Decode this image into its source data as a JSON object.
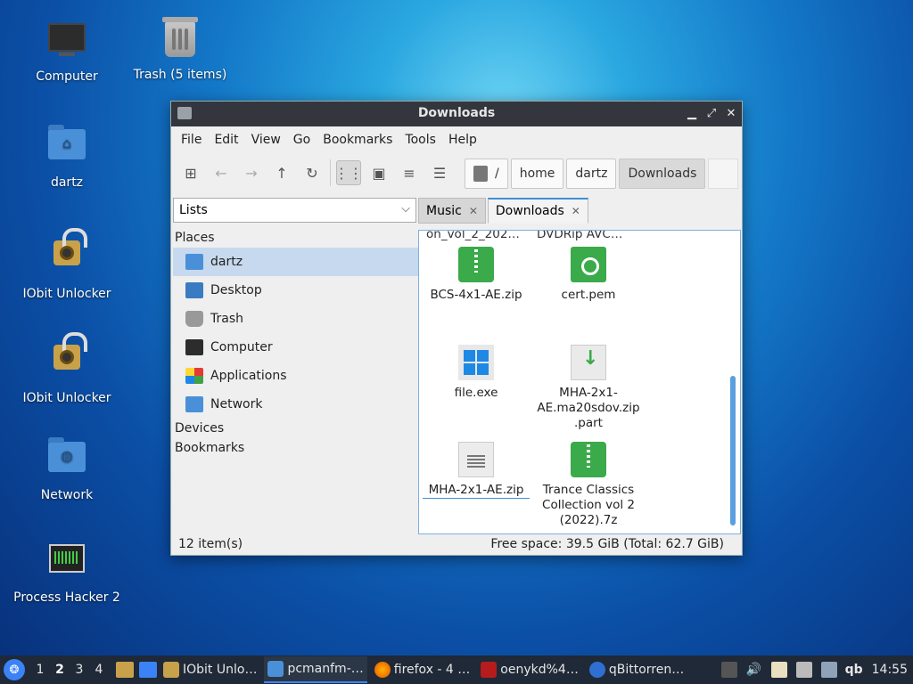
{
  "desktop": {
    "icons": [
      {
        "label": "Computer"
      },
      {
        "label": "Trash (5 items)"
      },
      {
        "label": "dartz"
      },
      {
        "label": "IObit Unlocker"
      },
      {
        "label": "IObit Unlocker"
      },
      {
        "label": "Network"
      },
      {
        "label": "Process Hacker 2"
      }
    ]
  },
  "window": {
    "title": "Downloads",
    "menu": [
      "File",
      "Edit",
      "View",
      "Go",
      "Bookmarks",
      "Tools",
      "Help"
    ],
    "path": [
      "/",
      "home",
      "dartz",
      "Downloads"
    ],
    "sidebar_mode": "Lists",
    "tabs": [
      {
        "label": "Music"
      },
      {
        "label": "Downloads"
      }
    ],
    "places_header": "Places",
    "places": [
      "dartz",
      "Desktop",
      "Trash",
      "Computer",
      "Applications",
      "Network"
    ],
    "devices_header": "Devices",
    "bookmarks_header": "Bookmarks",
    "files_partial": [
      "on_vol_2_202…",
      "DVDRip AVC…"
    ],
    "files": [
      {
        "name": "BCS-4x1-AE.zip",
        "icon": "zip-archive-icon"
      },
      {
        "name": "cert.pem",
        "icon": "certificate-icon"
      },
      {
        "name": "file.exe",
        "icon": "windows-exe-icon"
      },
      {
        "name": "MHA-2x1-AE.ma20sdov.zip.part",
        "name_lines": [
          "MHA-2x1-",
          "AE.ma20sdov.zip",
          ".part"
        ],
        "icon": "partial-download-icon"
      },
      {
        "name": "MHA-2x1-AE.zip",
        "icon": "text-file-icon"
      },
      {
        "name": "Trance Classics Collection vol 2 (2022).7z",
        "name_lines": [
          "Trance Classics",
          "Collection vol 2",
          "(2022).7z"
        ],
        "icon": "zip-archive-icon"
      }
    ],
    "status_left": "12 item(s)",
    "status_right": "Free space: 39.5 GiB (Total: 62.7 GiB)"
  },
  "taskbar": {
    "workspaces": [
      "1",
      "2",
      "3",
      "4"
    ],
    "current_workspace": "2",
    "tasks": [
      {
        "label": "IObit Unlo…"
      },
      {
        "label": "pcmanfm-…"
      },
      {
        "label": "firefox - 4 …"
      },
      {
        "label": "oenykd%4…"
      },
      {
        "label": "qBittorren…"
      }
    ],
    "tray_label": "qb",
    "clock": "14:55"
  },
  "colors": {
    "accent": "#3d8fd6",
    "titlebar": "#33373d",
    "taskbar": "#1f2937",
    "archive_green": "#3aaa4a"
  }
}
